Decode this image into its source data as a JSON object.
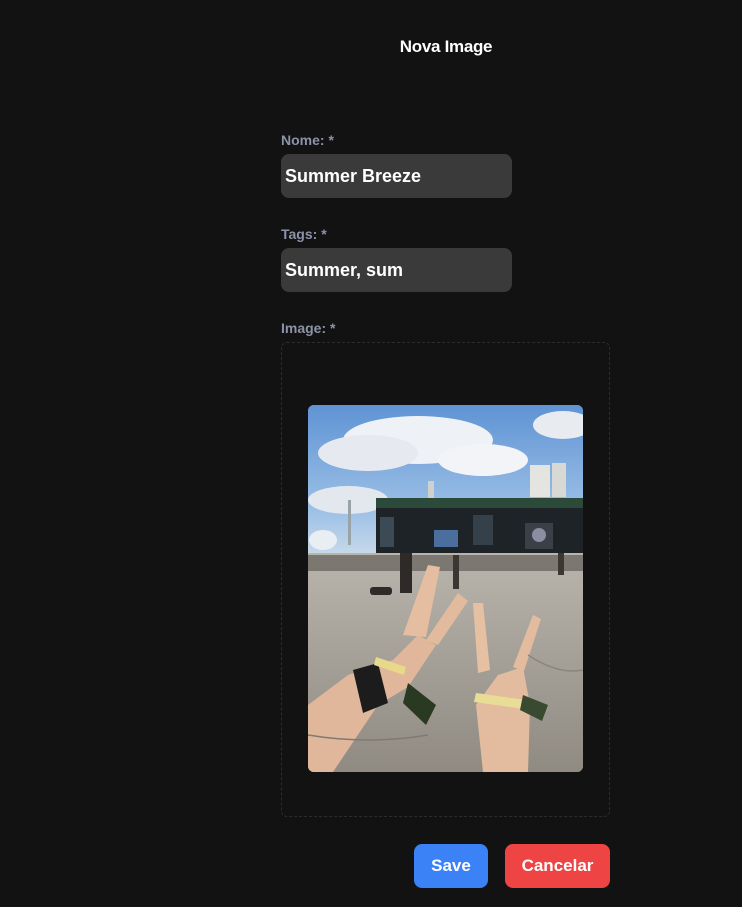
{
  "header": {
    "title": "Nova Image"
  },
  "form": {
    "name": {
      "label": "Nome: *",
      "value": "Summer Breeze"
    },
    "tags": {
      "label": "Tags: *",
      "value": "Summer, sum"
    },
    "image": {
      "label": "Image: *"
    }
  },
  "actions": {
    "save_label": "Save",
    "cancel_label": "Cancelar"
  },
  "colors": {
    "background": "#121212",
    "input_bg": "#3a3a3a",
    "label": "#8c93a8",
    "save": "#3b82f6",
    "cancel": "#ef4444"
  }
}
